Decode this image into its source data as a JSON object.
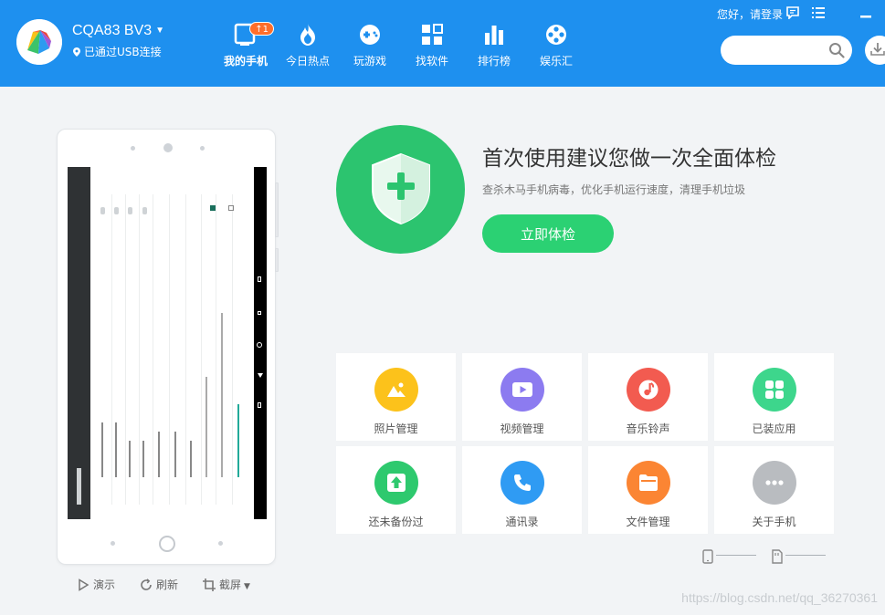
{
  "header": {
    "device_name": "CQA83 BV3",
    "device_status": "已通过USB连接",
    "greeting": "您好，请登录",
    "nav": [
      {
        "id": "my-phone",
        "label": "我的手机",
        "icon": "phone-icon",
        "badge": "↑1",
        "active": true
      },
      {
        "id": "hot-today",
        "label": "今日热点",
        "icon": "flame-icon"
      },
      {
        "id": "games",
        "label": "玩游戏",
        "icon": "gamepad-icon"
      },
      {
        "id": "software",
        "label": "找软件",
        "icon": "grid-apps-icon"
      },
      {
        "id": "ranking",
        "label": "排行榜",
        "icon": "bar-chart-icon"
      },
      {
        "id": "entertainment",
        "label": "娱乐汇",
        "icon": "film-reel-icon"
      }
    ],
    "search_placeholder": "",
    "accent_color": "#1e90ef"
  },
  "phone_tools": {
    "demo": "演示",
    "refresh": "刷新",
    "screenshot": "截屏"
  },
  "checkup": {
    "title": "首次使用建议您做一次全面体检",
    "subtitle": "查杀木马手机病毒，优化手机运行速度，清理手机垃圾",
    "button": "立即体检",
    "color": "#2cc46f"
  },
  "tiles": [
    {
      "label": "照片管理",
      "icon": "photo-icon",
      "color": "#fcc21b"
    },
    {
      "label": "视频管理",
      "icon": "video-icon",
      "color": "#8c7bf0"
    },
    {
      "label": "音乐铃声",
      "icon": "music-icon",
      "color": "#f25b50"
    },
    {
      "label": "已装应用",
      "icon": "apps-icon",
      "color": "#3dd68c"
    },
    {
      "label": "还未备份过",
      "icon": "backup-icon",
      "color": "#2ec96e"
    },
    {
      "label": "通讯录",
      "icon": "phone-call-icon",
      "color": "#2f9bf3"
    },
    {
      "label": "文件管理",
      "icon": "folder-icon",
      "color": "#fb8533"
    },
    {
      "label": "关于手机",
      "icon": "more-icon",
      "color": "#b9bcc0"
    }
  ],
  "watermark": "https://blog.csdn.net/qq_36270361"
}
